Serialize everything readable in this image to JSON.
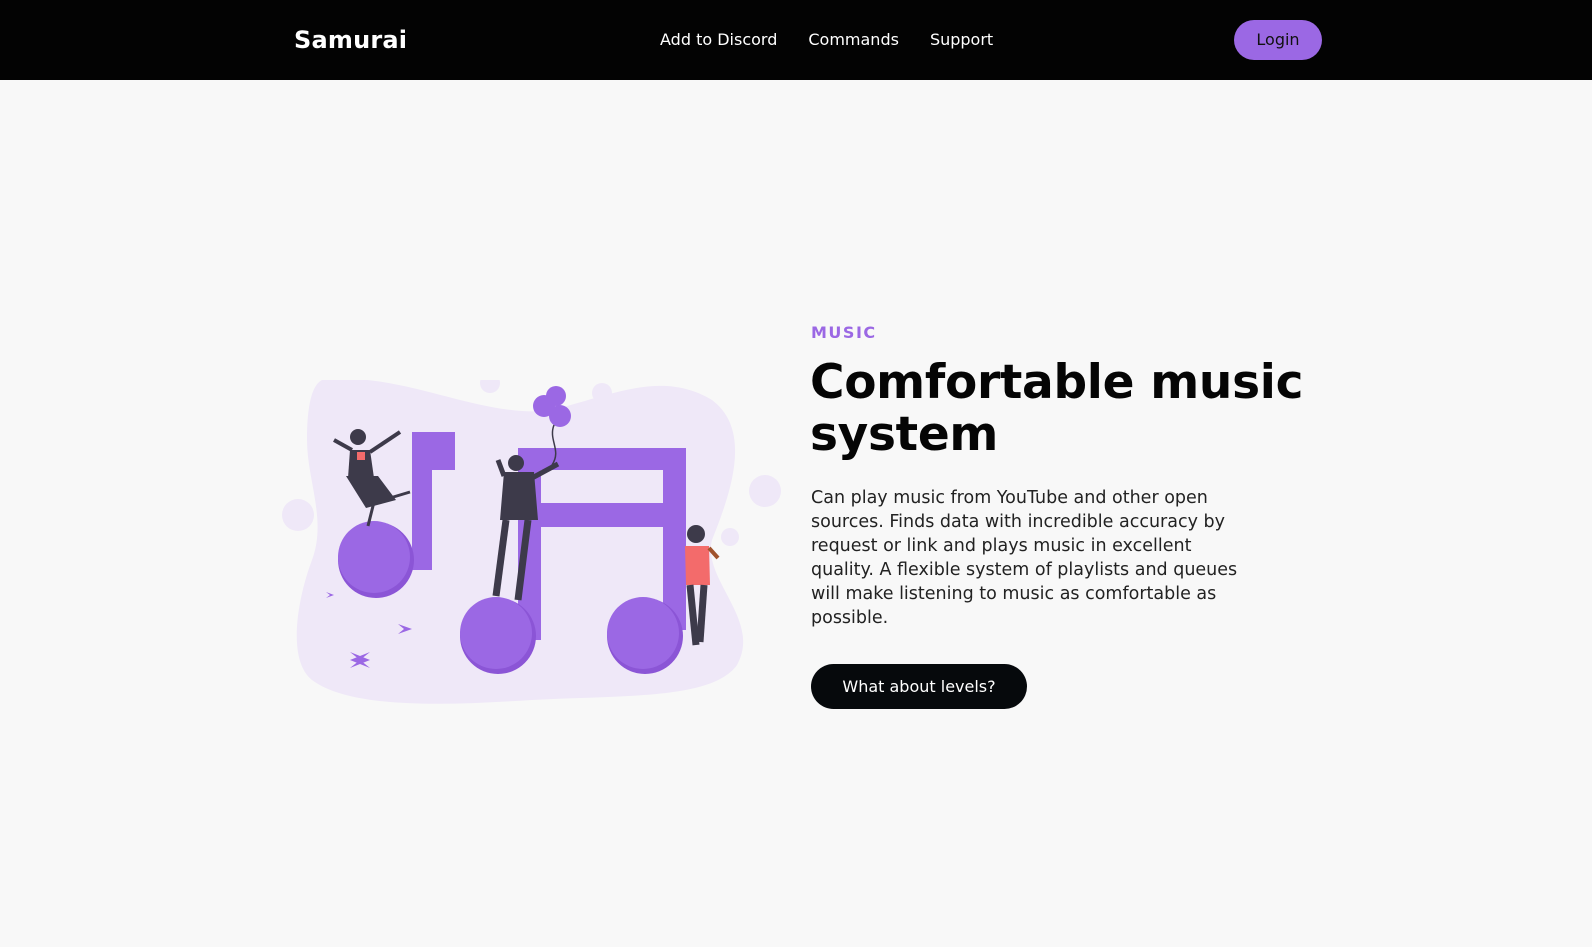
{
  "navbar": {
    "brand": "Samurai",
    "links": [
      {
        "label": "Add to Discord"
      },
      {
        "label": "Commands"
      },
      {
        "label": "Support"
      }
    ],
    "login_label": "Login"
  },
  "hero": {
    "eyebrow": "MUSIC",
    "title": "Comfortable music system",
    "description": "Can play music from YouTube and other open sources. Finds data with incredible accuracy by request or link and plays music in excellent quality. A flexible system of playlists and queues will make listening to music as comfortable as possible.",
    "cta_label": "What about levels?",
    "illustration": "music-notes-people-illustration"
  },
  "colors": {
    "navbar_bg": "#030303",
    "page_bg": "#f8f8f8",
    "accent": "#9b68e4",
    "accent_light": "#efe8f8",
    "button_dark": "#06090c",
    "figure_dark": "#3d3a4a",
    "figure_accent": "#f36b6b"
  }
}
